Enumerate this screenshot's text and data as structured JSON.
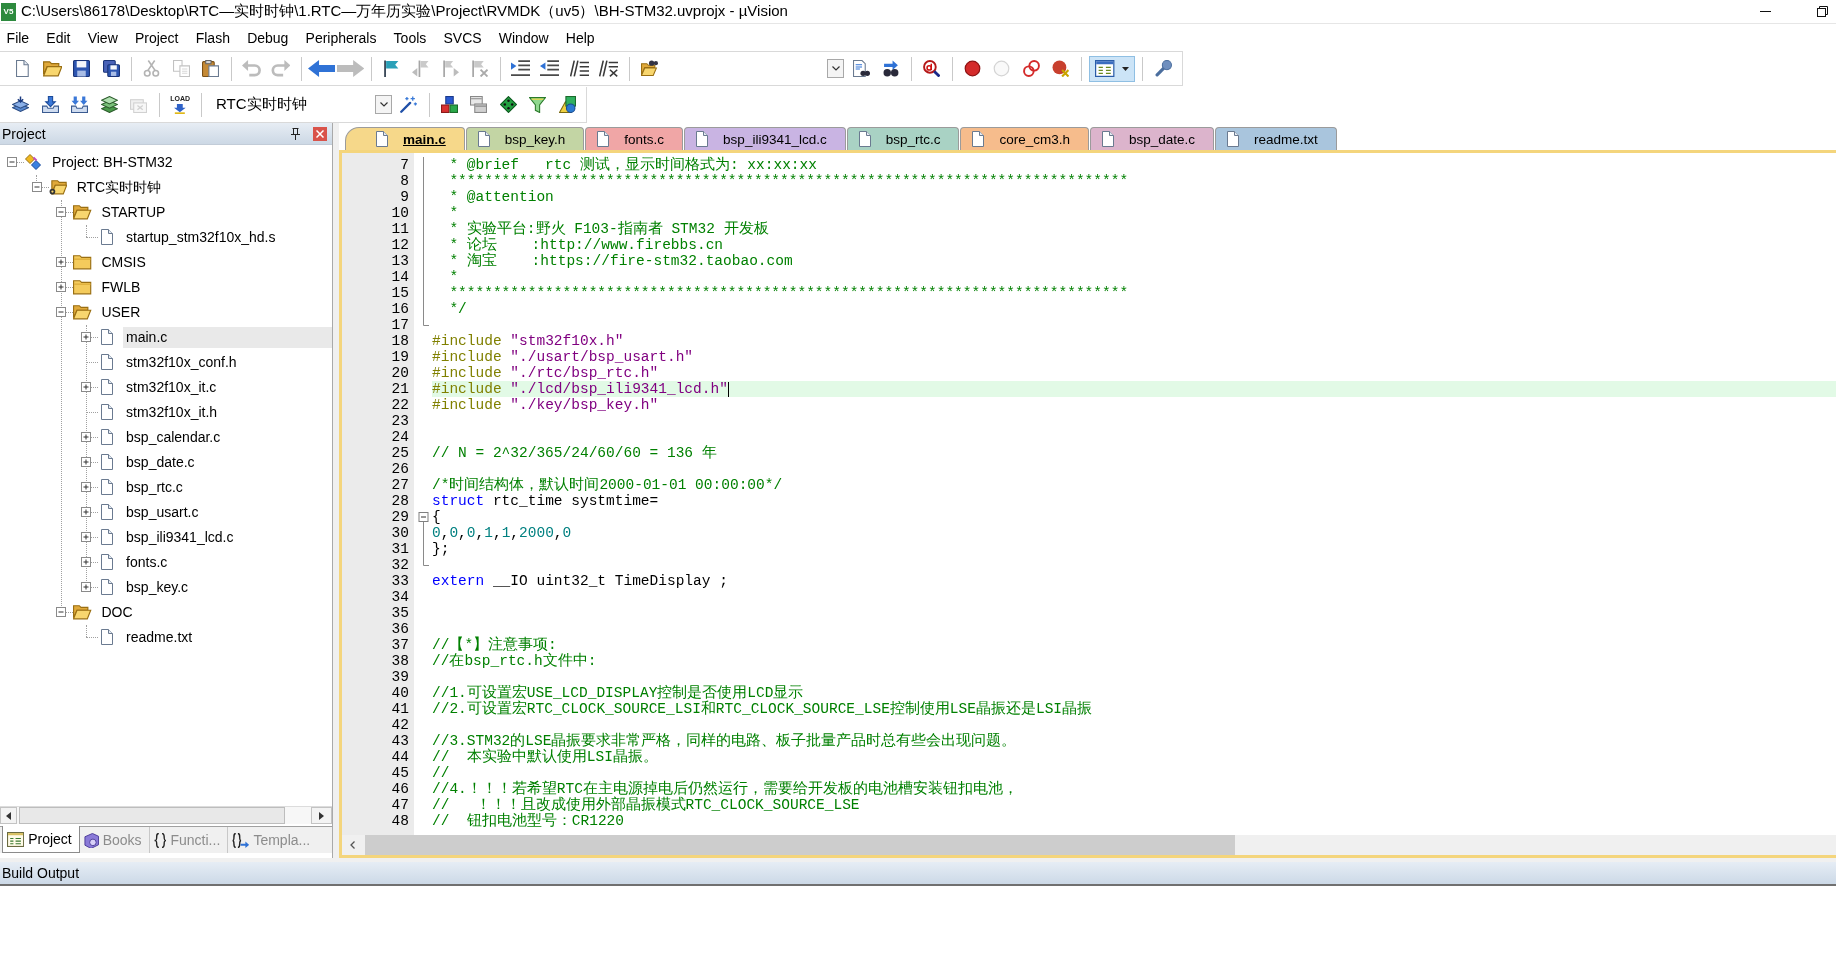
{
  "window": {
    "icon_label": "V5",
    "title": "C:\\Users\\86178\\Desktop\\RTC—实时时钟\\1.RTC—万年历实验\\Project\\RVMDK（uv5）\\BH-STM32.uvprojx - µVision"
  },
  "menu": [
    "File",
    "Edit",
    "View",
    "Project",
    "Flash",
    "Debug",
    "Peripherals",
    "Tools",
    "SVCS",
    "Window",
    "Help"
  ],
  "toolbars": [
    {
      "groups": [
        {
          "items": [
            {
              "kind": "button",
              "disabled": false,
              "pressed": false
            },
            {
              "kind": "button",
              "disabled": false,
              "pressed": false
            },
            {
              "kind": "button",
              "disabled": false,
              "pressed": false
            },
            {
              "kind": "button",
              "disabled": false,
              "pressed": false
            }
          ]
        },
        {
          "items": [
            {
              "kind": "button",
              "disabled": true,
              "pressed": false
            },
            {
              "kind": "button",
              "disabled": true,
              "pressed": false
            },
            {
              "kind": "button",
              "disabled": false,
              "pressed": false
            }
          ]
        },
        {
          "items": [
            {
              "kind": "button",
              "disabled": true,
              "pressed": false
            },
            {
              "kind": "button",
              "disabled": true,
              "pressed": false
            }
          ]
        },
        {
          "items": [
            {
              "kind": "button",
              "disabled": false,
              "pressed": false
            },
            {
              "kind": "button",
              "disabled": true,
              "pressed": false
            }
          ]
        },
        {
          "items": [
            {
              "kind": "button",
              "disabled": false,
              "pressed": false
            },
            {
              "kind": "button",
              "disabled": true,
              "pressed": false
            },
            {
              "kind": "button",
              "disabled": true,
              "pressed": false
            },
            {
              "kind": "button",
              "disabled": true,
              "pressed": false
            }
          ]
        },
        {
          "items": [
            {
              "kind": "button",
              "disabled": false,
              "pressed": false
            },
            {
              "kind": "button",
              "disabled": false,
              "pressed": false
            },
            {
              "kind": "button",
              "disabled": false,
              "pressed": false
            },
            {
              "kind": "button",
              "disabled": false,
              "pressed": false
            }
          ]
        },
        {
          "items": [
            {
              "kind": "button",
              "disabled": false,
              "pressed": false
            },
            {
              "kind": "combo"
            },
            {
              "kind": "button",
              "disabled": false,
              "pressed": false
            },
            {
              "kind": "button",
              "disabled": false,
              "pressed": false
            }
          ]
        },
        {
          "items": [
            {
              "kind": "button",
              "disabled": false,
              "pressed": false
            }
          ]
        },
        {
          "items": [
            {
              "kind": "button",
              "disabled": false,
              "pressed": false
            },
            {
              "kind": "button",
              "disabled": true,
              "pressed": false
            },
            {
              "kind": "button",
              "disabled": false,
              "pressed": false
            },
            {
              "kind": "button",
              "disabled": false,
              "pressed": false
            }
          ]
        },
        {
          "items": [
            {
              "kind": "menu-button",
              "disabled": false,
              "pressed": true
            }
          ]
        },
        {
          "items": [
            {
              "kind": "button",
              "disabled": false,
              "pressed": false
            }
          ]
        }
      ]
    },
    {
      "groups": [
        {
          "items": [
            {
              "kind": "button",
              "disabled": false,
              "pressed": false
            },
            {
              "kind": "button",
              "disabled": false,
              "pressed": false
            },
            {
              "kind": "button",
              "disabled": false,
              "pressed": false
            },
            {
              "kind": "button",
              "disabled": false,
              "pressed": false
            },
            {
              "kind": "button",
              "disabled": true,
              "pressed": false
            }
          ]
        },
        {
          "items": [
            {
              "kind": "button",
              "label": "LOAD",
              "disabled": false,
              "pressed": false
            }
          ]
        },
        {
          "items": [
            {
              "kind": "combo",
              "value": "RTC实时时钟"
            },
            {
              "kind": "button",
              "disabled": false,
              "pressed": false
            }
          ]
        },
        {
          "items": [
            {
              "kind": "button",
              "disabled": false,
              "pressed": false
            },
            {
              "kind": "button",
              "disabled": false,
              "pressed": false
            },
            {
              "kind": "button",
              "disabled": false,
              "pressed": false
            },
            {
              "kind": "button",
              "disabled": false,
              "pressed": false
            },
            {
              "kind": "button",
              "disabled": false,
              "pressed": false
            }
          ]
        }
      ]
    }
  ],
  "project_panel": {
    "title": "Project",
    "tree": [
      {
        "label": "Project: BH-STM32",
        "kind": "project",
        "expandable": true,
        "expanded": true,
        "selected": false,
        "children": [
          {
            "label": "RTC实时时钟",
            "kind": "target",
            "expandable": true,
            "expanded": true,
            "selected": false,
            "children": [
              {
                "label": "STARTUP",
                "kind": "group",
                "expandable": true,
                "expanded": true,
                "selected": false,
                "children": [
                  {
                    "label": "startup_stm32f10x_hd.s",
                    "kind": "file",
                    "expandable": false,
                    "selected": false
                  }
                ]
              },
              {
                "label": "CMSIS",
                "kind": "group",
                "expandable": true,
                "expanded": false,
                "selected": false
              },
              {
                "label": "FWLB",
                "kind": "group",
                "expandable": true,
                "expanded": false,
                "selected": false
              },
              {
                "label": "USER",
                "kind": "group",
                "expandable": true,
                "expanded": true,
                "selected": false,
                "children": [
                  {
                    "label": "main.c",
                    "kind": "file",
                    "expandable": true,
                    "expanded": false,
                    "selected": true
                  },
                  {
                    "label": "stm32f10x_conf.h",
                    "kind": "file",
                    "expandable": false,
                    "selected": false
                  },
                  {
                    "label": "stm32f10x_it.c",
                    "kind": "file",
                    "expandable": true,
                    "expanded": false,
                    "selected": false
                  },
                  {
                    "label": "stm32f10x_it.h",
                    "kind": "file",
                    "expandable": false,
                    "selected": false
                  },
                  {
                    "label": "bsp_calendar.c",
                    "kind": "file",
                    "expandable": true,
                    "expanded": false,
                    "selected": false
                  },
                  {
                    "label": "bsp_date.c",
                    "kind": "file",
                    "expandable": true,
                    "expanded": false,
                    "selected": false
                  },
                  {
                    "label": "bsp_rtc.c",
                    "kind": "file",
                    "expandable": true,
                    "expanded": false,
                    "selected": false
                  },
                  {
                    "label": "bsp_usart.c",
                    "kind": "file",
                    "expandable": true,
                    "expanded": false,
                    "selected": false
                  },
                  {
                    "label": "bsp_ili9341_lcd.c",
                    "kind": "file",
                    "expandable": true,
                    "expanded": false,
                    "selected": false
                  },
                  {
                    "label": "fonts.c",
                    "kind": "file",
                    "expandable": true,
                    "expanded": false,
                    "selected": false
                  },
                  {
                    "label": "bsp_key.c",
                    "kind": "file",
                    "expandable": true,
                    "expanded": false,
                    "selected": false
                  }
                ]
              },
              {
                "label": "DOC",
                "kind": "group",
                "expandable": true,
                "expanded": true,
                "selected": false,
                "children": [
                  {
                    "label": "readme.txt",
                    "kind": "file",
                    "expandable": false,
                    "selected": false
                  }
                ]
              }
            ]
          }
        ]
      }
    ],
    "tabs": [
      {
        "label": "Project",
        "selected": true
      },
      {
        "label": "Books",
        "selected": false
      },
      {
        "label": "Functi...",
        "selected": false
      },
      {
        "label": "Templa...",
        "selected": false
      }
    ]
  },
  "editor": {
    "tabs": [
      {
        "label": "main.c",
        "selected": true,
        "color": "#f6d88a"
      },
      {
        "label": "bsp_key.h",
        "selected": false,
        "color": "#c3d5a4"
      },
      {
        "label": "fonts.c",
        "selected": false,
        "color": "#f0a6a6"
      },
      {
        "label": "bsp_ili9341_lcd.c",
        "selected": false,
        "color": "#c9b4e3"
      },
      {
        "label": "bsp_rtc.c",
        "selected": false,
        "color": "#a9d2c4"
      },
      {
        "label": "core_cm3.h",
        "selected": false,
        "color": "#f6bc8c"
      },
      {
        "label": "bsp_date.c",
        "selected": false,
        "color": "#dcb4cc"
      },
      {
        "label": "readme.txt",
        "selected": false,
        "color": "#a9c5dd"
      }
    ],
    "lines": [
      {
        "number": "7",
        "kind": "inside",
        "current": false,
        "segments": [
          {
            "kind": "comment",
            "text": "  * @brief   rtc 测试，显示时间格式为: xx:xx:xx"
          }
        ]
      },
      {
        "number": "8",
        "kind": "inside",
        "current": false,
        "segments": [
          {
            "kind": "comment",
            "text": "  ******************************************************************************"
          }
        ]
      },
      {
        "number": "9",
        "kind": "inside",
        "current": false,
        "segments": [
          {
            "kind": "comment",
            "text": "  * @attention"
          }
        ]
      },
      {
        "number": "10",
        "kind": "inside",
        "current": false,
        "segments": [
          {
            "kind": "comment",
            "text": "  *"
          }
        ]
      },
      {
        "number": "11",
        "kind": "inside",
        "current": false,
        "segments": [
          {
            "kind": "comment",
            "text": "  * 实验平台:野火 F103-指南者 STM32 开发板"
          }
        ]
      },
      {
        "number": "12",
        "kind": "inside",
        "current": false,
        "segments": [
          {
            "kind": "comment",
            "text": "  * 论坛    :http://www.firebbs.cn"
          }
        ]
      },
      {
        "number": "13",
        "kind": "inside",
        "current": false,
        "segments": [
          {
            "kind": "comment",
            "text": "  * 淘宝    :https://fire-stm32.taobao.com"
          }
        ]
      },
      {
        "number": "14",
        "kind": "inside",
        "current": false,
        "segments": [
          {
            "kind": "comment",
            "text": "  *"
          }
        ]
      },
      {
        "number": "15",
        "kind": "inside",
        "current": false,
        "segments": [
          {
            "kind": "comment",
            "text": "  ******************************************************************************"
          }
        ]
      },
      {
        "number": "16",
        "kind": "inside",
        "current": false,
        "segments": [
          {
            "kind": "comment",
            "text": "  */"
          }
        ]
      },
      {
        "number": "17",
        "kind": "end",
        "current": false
      },
      {
        "number": "18",
        "kind": "plain",
        "current": false,
        "segments": [
          {
            "kind": "preprocessor",
            "text": "#include "
          },
          {
            "kind": "string",
            "text": "\"stm32f10x.h\""
          }
        ]
      },
      {
        "number": "19",
        "kind": "plain",
        "current": false,
        "segments": [
          {
            "kind": "preprocessor",
            "text": "#include "
          },
          {
            "kind": "string",
            "text": "\"./usart/bsp_usart.h\""
          }
        ]
      },
      {
        "number": "20",
        "kind": "plain",
        "current": false,
        "segments": [
          {
            "kind": "preprocessor",
            "text": "#include "
          },
          {
            "kind": "string",
            "text": "\"./rtc/bsp_rtc.h\""
          }
        ]
      },
      {
        "number": "21",
        "kind": "plain",
        "current": true,
        "segments": [
          {
            "kind": "preprocessor",
            "text": "#include "
          },
          {
            "kind": "string",
            "text": "\"./lcd/bsp_ili9341_lcd.h\""
          }
        ]
      },
      {
        "number": "22",
        "kind": "plain",
        "current": false,
        "segments": [
          {
            "kind": "preprocessor",
            "text": "#include "
          },
          {
            "kind": "string",
            "text": "\"./key/bsp_key.h\""
          }
        ]
      },
      {
        "number": "23",
        "kind": "plain",
        "current": false
      },
      {
        "number": "24",
        "kind": "plain",
        "current": false
      },
      {
        "number": "25",
        "kind": "plain",
        "current": false,
        "segments": [
          {
            "kind": "comment",
            "text": "// N = 2^32/365/24/60/60 = 136 年"
          }
        ]
      },
      {
        "number": "26",
        "kind": "plain",
        "current": false
      },
      {
        "number": "27",
        "kind": "plain",
        "current": false,
        "segments": [
          {
            "kind": "comment",
            "text": "/*时间结构体，默认时间2000-01-01 00:00:00*/"
          }
        ]
      },
      {
        "number": "28",
        "kind": "plain",
        "current": false,
        "segments": [
          {
            "kind": "keyword",
            "text": "struct"
          },
          {
            "kind": "plain",
            "text": " rtc_time systmtime="
          }
        ]
      },
      {
        "number": "29",
        "kind": "start",
        "current": false,
        "segments": [
          {
            "kind": "plain",
            "text": "{"
          }
        ]
      },
      {
        "number": "30",
        "kind": "inside",
        "current": false,
        "segments": [
          {
            "kind": "number",
            "text": "0"
          },
          {
            "kind": "plain",
            "text": ","
          },
          {
            "kind": "number",
            "text": "0"
          },
          {
            "kind": "plain",
            "text": ","
          },
          {
            "kind": "number",
            "text": "0"
          },
          {
            "kind": "plain",
            "text": ","
          },
          {
            "kind": "number",
            "text": "1"
          },
          {
            "kind": "plain",
            "text": ","
          },
          {
            "kind": "number",
            "text": "1"
          },
          {
            "kind": "plain",
            "text": ","
          },
          {
            "kind": "number",
            "text": "2000"
          },
          {
            "kind": "plain",
            "text": ","
          },
          {
            "kind": "number",
            "text": "0"
          }
        ]
      },
      {
        "number": "31",
        "kind": "inside",
        "current": false,
        "segments": [
          {
            "kind": "plain",
            "text": "};"
          }
        ]
      },
      {
        "number": "32",
        "kind": "end",
        "current": false
      },
      {
        "number": "33",
        "kind": "plain",
        "current": false,
        "segments": [
          {
            "kind": "keyword",
            "text": "extern"
          },
          {
            "kind": "plain",
            "text": " __IO uint32_t TimeDisplay ;"
          }
        ]
      },
      {
        "number": "34",
        "kind": "plain",
        "current": false
      },
      {
        "number": "35",
        "kind": "plain",
        "current": false
      },
      {
        "number": "36",
        "kind": "plain",
        "current": false
      },
      {
        "number": "37",
        "kind": "plain",
        "current": false,
        "segments": [
          {
            "kind": "comment",
            "text": "//【*】注意事项:"
          }
        ]
      },
      {
        "number": "38",
        "kind": "plain",
        "current": false,
        "segments": [
          {
            "kind": "comment",
            "text": "//在bsp_rtc.h文件中:"
          }
        ]
      },
      {
        "number": "39",
        "kind": "plain",
        "current": false
      },
      {
        "number": "40",
        "kind": "plain",
        "current": false,
        "segments": [
          {
            "kind": "comment",
            "text": "//1.可设置宏USE_LCD_DISPLAY控制是否使用LCD显示"
          }
        ]
      },
      {
        "number": "41",
        "kind": "plain",
        "current": false,
        "segments": [
          {
            "kind": "comment",
            "text": "//2.可设置宏RTC_CLOCK_SOURCE_LSI和RTC_CLOCK_SOURCE_LSE控制使用LSE晶振还是LSI晶振"
          }
        ]
      },
      {
        "number": "42",
        "kind": "plain",
        "current": false
      },
      {
        "number": "43",
        "kind": "plain",
        "current": false,
        "segments": [
          {
            "kind": "comment",
            "text": "//3.STM32的LSE晶振要求非常严格，同样的电路、板子批量产品时总有些会出现问题。"
          }
        ]
      },
      {
        "number": "44",
        "kind": "plain",
        "current": false,
        "segments": [
          {
            "kind": "comment",
            "text": "//  本实验中默认使用LSI晶振。"
          }
        ]
      },
      {
        "number": "45",
        "kind": "plain",
        "current": false,
        "segments": [
          {
            "kind": "comment",
            "text": "//"
          }
        ]
      },
      {
        "number": "46",
        "kind": "plain",
        "current": false,
        "segments": [
          {
            "kind": "comment",
            "text": "//4.！！！若希望RTC在主电源掉电后仍然运行，需要给开发板的电池槽安装钮扣电池，"
          }
        ]
      },
      {
        "number": "47",
        "kind": "plain",
        "current": false,
        "segments": [
          {
            "kind": "comment",
            "text": "//   ！！！且改成使用外部晶振模式RTC_CLOCK_SOURCE_LSE"
          }
        ]
      },
      {
        "number": "48",
        "kind": "plain",
        "current": false,
        "segments": [
          {
            "kind": "comment",
            "text": "//  钮扣电池型号：CR1220"
          }
        ]
      }
    ]
  },
  "build_output": {
    "title": "Build Output"
  }
}
